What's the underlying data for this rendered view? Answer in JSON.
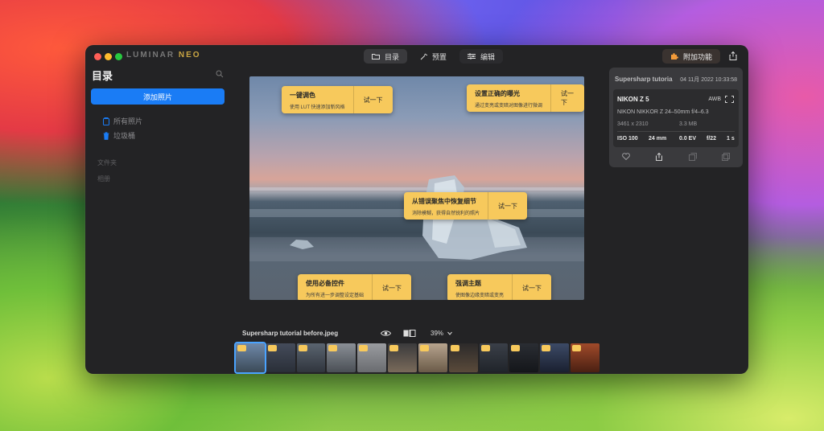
{
  "app": {
    "logo_main": "LUMINAR",
    "logo_accent": "NEO"
  },
  "nav": {
    "tabs": [
      {
        "label": "目录",
        "icon": "folder-icon"
      },
      {
        "label": "预置",
        "icon": "magic-wand-icon"
      },
      {
        "label": "编辑",
        "icon": "sliders-icon"
      }
    ]
  },
  "toolbar": {
    "addon_label": "附加功能"
  },
  "sidebar": {
    "title": "目录",
    "add_photo_label": "添加照片",
    "items": [
      {
        "label": "所有照片",
        "icon": "photos-icon"
      },
      {
        "label": "垃圾桶",
        "icon": "trash-icon"
      }
    ],
    "sections": [
      "文件夹",
      "相册"
    ]
  },
  "canvas": {
    "tips": [
      {
        "title": "一键调色",
        "sub": "使用 LUT 快速添加新风格",
        "button": "试一下"
      },
      {
        "title": "设置正确的曝光",
        "sub": "通过变亮或变暗对图像进行微调",
        "button": "试一下"
      },
      {
        "title": "从错误聚焦中恢复细节",
        "sub": "消除模糊，获得自然锐利的照片",
        "button": "试一下"
      },
      {
        "title": "使用必备控件",
        "sub": "为所有进一步调整设定基础",
        "button": "试一下"
      },
      {
        "title": "强调主题",
        "sub": "使图像边缘变暗或变亮",
        "button": "试一下"
      }
    ]
  },
  "filebar": {
    "filename": "Supersharp tutorial before.jpeg",
    "zoom": "39%"
  },
  "info": {
    "filename": "Supersharp tutorial",
    "datetime": "04 11月 2022 10:33:58",
    "camera": "NIKON Z 5",
    "white_balance": "AWB",
    "lens": "NIKON NIKKOR Z 24–50mm f/4–6.3",
    "resolution": "3461 x 2310",
    "filesize": "3.3 MB",
    "iso": "ISO 100",
    "focal": "24 mm",
    "ev": "0.0 EV",
    "aperture": "f/22",
    "shutter": "1 s"
  },
  "filmstrip": {
    "thumbs": [
      {
        "colors": [
          "#6f88a9",
          "#3b4a57"
        ],
        "selected": true
      },
      {
        "colors": [
          "#444b5a",
          "#2a2f38"
        ],
        "selected": false
      },
      {
        "colors": [
          "#5a6470",
          "#30353d"
        ],
        "selected": false
      },
      {
        "colors": [
          "#8a8f96",
          "#4a4f55"
        ],
        "selected": false
      },
      {
        "colors": [
          "#9a9ca0",
          "#6a6c70"
        ],
        "selected": false
      },
      {
        "colors": [
          "#3a3a3c",
          "#7a6a5a"
        ],
        "selected": false
      },
      {
        "colors": [
          "#b7a48e",
          "#6a5a48"
        ],
        "selected": false
      },
      {
        "colors": [
          "#2c2a2a",
          "#5a4a3a"
        ],
        "selected": false
      },
      {
        "colors": [
          "#3a3f48",
          "#20242a"
        ],
        "selected": false
      },
      {
        "colors": [
          "#2a2d33",
          "#14161a"
        ],
        "selected": false
      },
      {
        "colors": [
          "#3c4a66",
          "#1a2030"
        ],
        "selected": false
      },
      {
        "colors": [
          "#a04a2a",
          "#4a2012"
        ],
        "selected": false
      }
    ]
  }
}
